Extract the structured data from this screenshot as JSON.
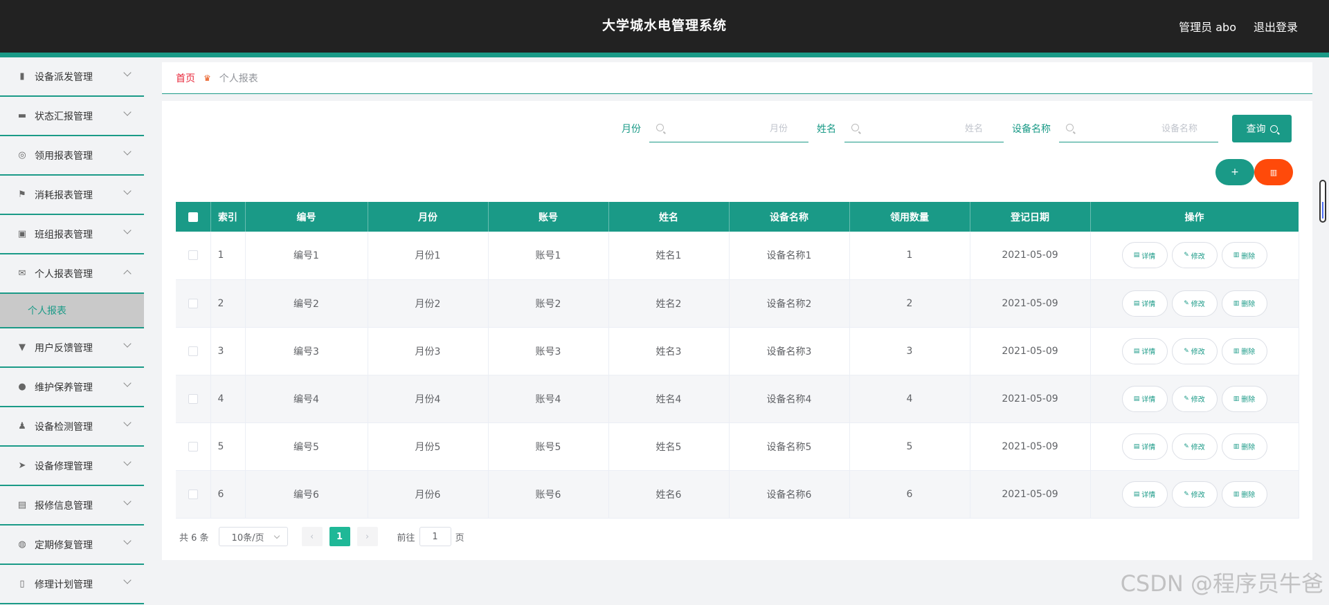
{
  "header": {
    "title": "大学城水电管理系统",
    "user": "管理员 abo",
    "logout": "退出登录"
  },
  "sidebar": {
    "items": [
      {
        "label": "设备派发管理",
        "icon": "bar-chart-icon",
        "glyph": "▮"
      },
      {
        "label": "状态汇报管理",
        "icon": "monitor-icon",
        "glyph": "▬"
      },
      {
        "label": "领用报表管理",
        "icon": "lifebuoy-icon",
        "glyph": "◎"
      },
      {
        "label": "消耗报表管理",
        "icon": "flag-icon",
        "glyph": "⚑"
      },
      {
        "label": "班组报表管理",
        "icon": "clipboard-check-icon",
        "glyph": "▣"
      },
      {
        "label": "个人报表管理",
        "icon": "mail-icon",
        "glyph": "✉",
        "expanded": true
      },
      {
        "label": "用户反馈管理",
        "icon": "stamp-icon",
        "glyph": "▼"
      },
      {
        "label": "维护保养管理",
        "icon": "bulb-icon",
        "glyph": "●"
      },
      {
        "label": "设备检测管理",
        "icon": "user-icon",
        "glyph": "♟"
      },
      {
        "label": "设备修理管理",
        "icon": "send-icon",
        "glyph": "➤"
      },
      {
        "label": "报修信息管理",
        "icon": "document-x-icon",
        "glyph": "▤"
      },
      {
        "label": "定期修复管理",
        "icon": "compass-icon",
        "glyph": "◍"
      },
      {
        "label": "修理计划管理",
        "icon": "phone-icon",
        "glyph": "▯"
      }
    ],
    "submenu": "个人报表"
  },
  "breadcrumb": {
    "home": "首页",
    "current": "个人报表"
  },
  "search": {
    "month_label": "月份",
    "month_placeholder": "月份",
    "name_label": "姓名",
    "name_placeholder": "姓名",
    "device_label": "设备名称",
    "device_placeholder": "设备名称",
    "query_label": "查询"
  },
  "actions": {
    "add": "+",
    "delete": "🗑"
  },
  "table": {
    "columns": [
      "索引",
      "编号",
      "月份",
      "账号",
      "姓名",
      "设备名称",
      "领用数量",
      "登记日期",
      "操作"
    ],
    "rows": [
      [
        "1",
        "编号1",
        "月份1",
        "账号1",
        "姓名1",
        "设备名称1",
        "1",
        "2021-05-09"
      ],
      [
        "2",
        "编号2",
        "月份2",
        "账号2",
        "姓名2",
        "设备名称2",
        "2",
        "2021-05-09"
      ],
      [
        "3",
        "编号3",
        "月份3",
        "账号3",
        "姓名3",
        "设备名称3",
        "3",
        "2021-05-09"
      ],
      [
        "4",
        "编号4",
        "月份4",
        "账号4",
        "姓名4",
        "设备名称4",
        "4",
        "2021-05-09"
      ],
      [
        "5",
        "编号5",
        "月份5",
        "账号5",
        "姓名5",
        "设备名称5",
        "5",
        "2021-05-09"
      ],
      [
        "6",
        "编号6",
        "月份6",
        "账号6",
        "姓名6",
        "设备名称6",
        "6",
        "2021-05-09"
      ]
    ],
    "op_detail": "详情",
    "op_edit": "修改",
    "op_delete": "删除"
  },
  "pagination": {
    "total": "共 6 条",
    "page_size": "10条/页",
    "current_page": "1",
    "goto_label": "前往",
    "goto_value": "1",
    "page_suffix": "页"
  },
  "watermark": "CSDN @程序员牛爸",
  "colors": {
    "accent": "#1a9a87",
    "danger": "#ff4a0a",
    "header_bg": "#222222"
  }
}
